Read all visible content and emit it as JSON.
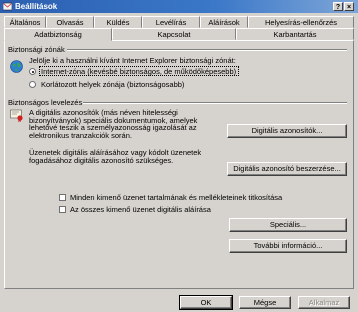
{
  "window": {
    "title": "Beállítások"
  },
  "tabs_back": [
    "Általános",
    "Olvasás",
    "Küldés",
    "Levélírás",
    "Aláírások",
    "Helyesírás-ellenőrzés"
  ],
  "tabs_front": [
    "Adatbiztonság",
    "Kapcsolat",
    "Karbantartás"
  ],
  "zones": {
    "heading": "Biztonsági zónák",
    "desc": "Jelölje ki a használni kívánt Internet Explorer biztonsági zónát:",
    "option_internet": "Internet-zóna (kevésbé biztonságos, de működőképesebb)",
    "option_restricted": "Korlátozott helyek zónája (biztonságosabb)"
  },
  "secure_mail": {
    "heading": "Biztonságos levelezés",
    "para1": [
      "A digitális azonosítók (más néven hitelességi",
      "bizonyítványok) speciális dokumentumok, amelyek",
      "lehetővé teszik a személyazonosság igazolását az",
      "elektronikus tranzakciók során."
    ],
    "digital_ids_button": "Digitális azonosítók...",
    "para2": [
      "Üzenetek digitális aláírásához vagy kódolt üzenetek",
      "fogadásához digitális azonosító szükséges."
    ],
    "get_id_button": "Digitális azonosító beszerzése...",
    "encrypt_check": "Minden kimenő üzenet tartalmának és mellékleteinek titkosítása",
    "sign_check": "Az összes kimenő üzenet digitális aláírása",
    "advanced_button": "Speciális...",
    "more_info_button": "További információ..."
  },
  "footer": {
    "ok": "OK",
    "cancel": "Mégse",
    "apply": "Alkalmaz"
  },
  "colors": {
    "titlebar": "#2c5fb0",
    "face": "#d6d3ce"
  }
}
